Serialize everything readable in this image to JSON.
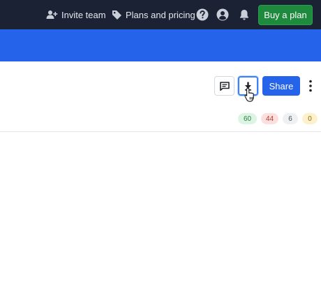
{
  "topbar": {
    "invite_label": "Invite team",
    "plans_label": "Plans and pricing",
    "buy_label": "Buy a plan"
  },
  "toolbar": {
    "share_label": "Share"
  },
  "counts": [
    {
      "value": "60",
      "bg": "#dcf5e3",
      "fg": "#2f7a43"
    },
    {
      "value": "44",
      "bg": "#fbe0dd",
      "fg": "#b23a2e"
    },
    {
      "value": "6",
      "bg": "#eef0f2",
      "fg": "#4a4f57"
    },
    {
      "value": "0",
      "bg": "#fdf1cc",
      "fg": "#8a6a12"
    }
  ],
  "colors": {
    "topbar": "#1b2233",
    "accent": "#2563eb",
    "buy": "#1e8a3e"
  }
}
